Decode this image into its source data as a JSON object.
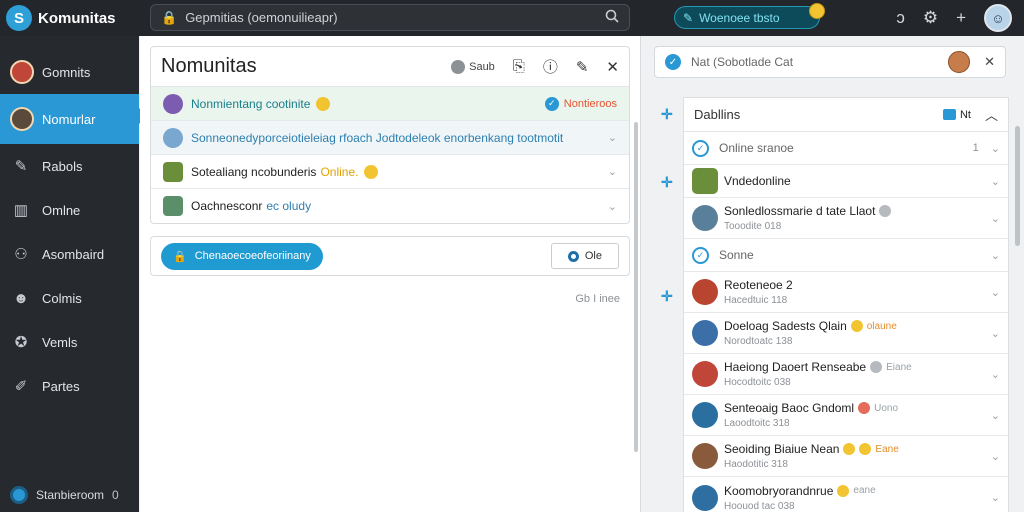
{
  "topbar": {
    "brand": "Komunitas",
    "search_value": "Gepmitias (oemonuilieapr)",
    "promo_label": "Woenoee tbsto"
  },
  "sidebar": {
    "items": [
      {
        "label": "Gomnits"
      },
      {
        "label": "Nomurlar"
      },
      {
        "label": "Rabols"
      },
      {
        "label": "Omlne"
      },
      {
        "label": "Asombaird"
      },
      {
        "label": "Colmis"
      },
      {
        "label": "Vemls"
      },
      {
        "label": "Partes"
      }
    ],
    "status_label": "Stanbieroom",
    "status_count": "0"
  },
  "center": {
    "title": "Nomunitas",
    "head_button": "Saub",
    "rows": [
      {
        "text": "Nonmientang cootinite",
        "badge": "Nontieroos"
      },
      {
        "text": "Sonneonedyporceiotieleiag rfoach Jodtodeleok enorbenkang tootmotit"
      },
      {
        "text": "Sotealiang ncobunderis",
        "online": "Online."
      },
      {
        "text": "Oachnesconr",
        "suffix": "ec oludy"
      }
    ],
    "compose_button": "Chenaoecoeofeoriinany",
    "ghost_button": "Ole",
    "timestamp": "Gb I inee"
  },
  "right": {
    "search_placeholder": "Nat (Sobotlade Cat",
    "list_title": "Dabllins",
    "toggle_label": "Nt",
    "items": [
      {
        "kind": "check",
        "name": "Online sranoe",
        "count": "1"
      },
      {
        "kind": "avatar",
        "name": "Vndedonline",
        "color": "#6b8e3a"
      },
      {
        "kind": "avatar",
        "name": "Sonledlossmarie d tate Llaot",
        "sub": "Tooodite 018",
        "emoji": "gray",
        "color": "#5a7f9a"
      },
      {
        "kind": "check",
        "name": "Sonne"
      },
      {
        "kind": "avatar",
        "name": "Reoteneoe 2",
        "sub": "Hacedtuic 118",
        "color": "#b9442f"
      },
      {
        "kind": "avatar",
        "name": "Doeloag Sadests Qlain",
        "sub": "Norodtoatc 138",
        "emoji": "yellow",
        "tag": "olaune",
        "tag_color": "orange",
        "color": "#3c6fa8"
      },
      {
        "kind": "avatar",
        "name": "Haeiong Daoert Renseabe",
        "sub": "Hocodtoitc 038",
        "emoji": "gray",
        "tag": "Eiane",
        "tag_color": "gray",
        "color": "#c0463a"
      },
      {
        "kind": "avatar",
        "name": "Senteoaig Baoc Gndoml",
        "sub": "Laoodtoitc 318",
        "emoji": "red",
        "tag": "Uono",
        "tag_color": "gray",
        "color": "#2a6fa0"
      },
      {
        "kind": "avatar",
        "name": "Seoiding Biaiue Nean",
        "sub": "Haodotitic 318",
        "emoji": "yellow",
        "tag": "Eane",
        "tag_color": "orange",
        "color": "#8a5a3c"
      },
      {
        "kind": "avatar",
        "name": "Koomobryorandnrue",
        "sub": "Hoouod tac 038",
        "emoji": "yellow",
        "tag": "eane",
        "tag_color": "gray",
        "color": "#2f6ea0"
      }
    ]
  }
}
